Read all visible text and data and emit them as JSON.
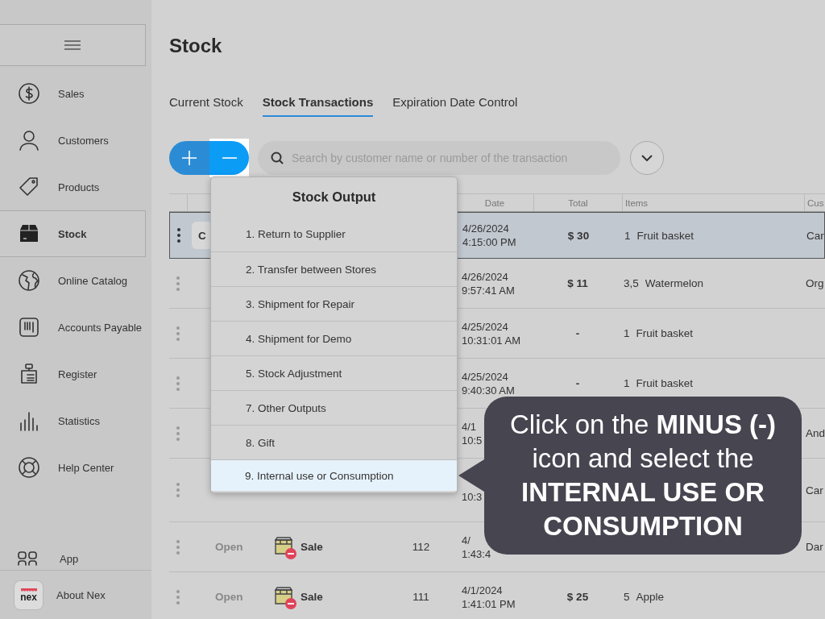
{
  "sidebar": {
    "items": [
      {
        "label": "Sales",
        "selected": false
      },
      {
        "label": "Customers",
        "selected": false
      },
      {
        "label": "Products",
        "selected": false
      },
      {
        "label": "Stock",
        "selected": true
      },
      {
        "label": "Online Catalog",
        "selected": false
      },
      {
        "label": "Accounts Payable",
        "selected": false
      },
      {
        "label": "Register",
        "selected": false
      },
      {
        "label": "Statistics",
        "selected": false
      },
      {
        "label": "Help Center",
        "selected": false
      }
    ],
    "app_label": "App",
    "about": {
      "logo": "nex",
      "label": "About Nex"
    }
  },
  "page_title": "Stock",
  "tabs": [
    {
      "label": "Current Stock",
      "selected": false
    },
    {
      "label": "Stock Transactions",
      "selected": true
    },
    {
      "label": "Expiration Date Control",
      "selected": false
    }
  ],
  "search": {
    "placeholder": "Search by customer name or number of the transaction"
  },
  "table": {
    "columns": [
      "Date",
      "Total",
      "Items",
      "Cus"
    ],
    "rows": [
      {
        "selected": true,
        "status": "C",
        "kind": "button",
        "date": "4/26/2024",
        "time": "4:15:00 PM",
        "total": "$ 30",
        "qty": "1",
        "item": "Fruit basket",
        "customer": "Car"
      },
      {
        "selected": false,
        "date": "4/26/2024",
        "time": "9:57:41 AM",
        "total": "$ 11",
        "qty": "3,5",
        "item": "Watermelon",
        "customer": "Org"
      },
      {
        "selected": false,
        "date": "4/25/2024",
        "time": "10:31:01 AM",
        "total": "-",
        "qty": "1",
        "item": "Fruit basket"
      },
      {
        "selected": false,
        "date": "4/25/2024",
        "time": "9:40:30 AM",
        "total": "-",
        "qty": "1",
        "item": "Fruit basket"
      },
      {
        "selected": false,
        "date": "4/1",
        "time": "10:5",
        "customer": "And"
      },
      {
        "selected": false,
        "time": "10:3",
        "customer": "Car"
      },
      {
        "selected": false,
        "status": "Open",
        "kind": "text",
        "type": "Sale",
        "number": "112",
        "date": "4/",
        "time": "1:43:4",
        "customer": "Dar"
      },
      {
        "selected": false,
        "status": "Open",
        "kind": "text",
        "type": "Sale",
        "number": "111",
        "date": "4/1/2024",
        "time": "1:41:01 PM",
        "total": "$ 25",
        "qty": "5",
        "item": "Apple"
      }
    ]
  },
  "menu": {
    "title": "Stock Output",
    "items": [
      {
        "label": "1. Return to Supplier",
        "selected": false
      },
      {
        "label": "2. Transfer between Stores",
        "selected": false
      },
      {
        "label": "3. Shipment for Repair",
        "selected": false
      },
      {
        "label": "4. Shipment for Demo",
        "selected": false
      },
      {
        "label": "5. Stock Adjustment",
        "selected": false
      },
      {
        "label": "7. Other Outputs",
        "selected": false
      },
      {
        "label": "8. Gift",
        "selected": false
      },
      {
        "label": "9. Internal use or Consumption",
        "selected": true
      }
    ]
  },
  "callout": {
    "text": "Click on the **MINUS (-)** icon and select the **INTERNAL USE OR CONSUMPTION**"
  }
}
